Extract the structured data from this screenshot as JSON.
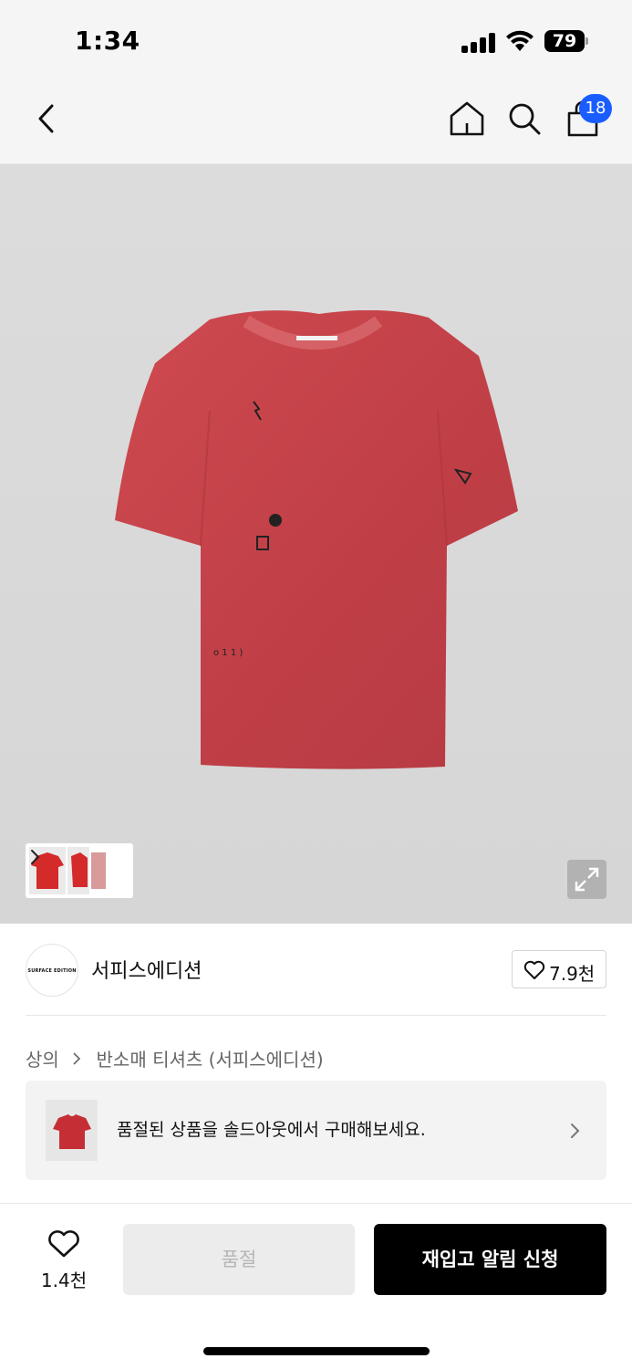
{
  "status_bar": {
    "time": "1:34",
    "battery": "79"
  },
  "nav": {
    "icons": [
      "back-icon",
      "home-icon",
      "search-icon",
      "bag-icon"
    ],
    "cart_count": "18"
  },
  "product": {
    "image_description": "red oversized short sleeve t-shirt",
    "shirt_color": "#c9434a",
    "thumbnail_count": 3
  },
  "brand": {
    "logo_text": "SURFACE EDITION",
    "name": "서피스에디션",
    "like_count": "7.9천"
  },
  "breadcrumb": {
    "category": "상의",
    "subcategory": "반소매 티셔츠 (서피스에디션)"
  },
  "soldout_banner": {
    "text": "품절된 상품을 솔드아웃에서 구매해보세요."
  },
  "bottom_bar": {
    "like_count": "1.4천",
    "soldout_label": "품절",
    "restock_label": "재입고 알림 신청"
  },
  "colors": {
    "accent": "#1a5dff",
    "primary_button": "#000000",
    "disabled_button": "#ececec"
  }
}
